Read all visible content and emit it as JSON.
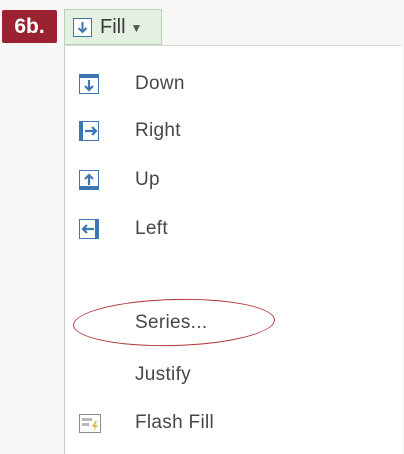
{
  "step_badge": "6b.",
  "fill_button": {
    "label": "Fill",
    "icon": "fill-down-icon",
    "accent": "#3d76b0"
  },
  "menu": {
    "items": [
      {
        "label": "Down",
        "icon": "arrow-down-icon"
      },
      {
        "label": "Right",
        "icon": "arrow-right-icon"
      },
      {
        "label": "Up",
        "icon": "arrow-up-icon"
      },
      {
        "label": "Left",
        "icon": "arrow-left-icon"
      },
      {
        "label": "Series..."
      },
      {
        "label": "Justify"
      },
      {
        "label": "Flash Fill",
        "icon": "flash-fill-icon"
      }
    ]
  },
  "annotation_color": "#b03636"
}
